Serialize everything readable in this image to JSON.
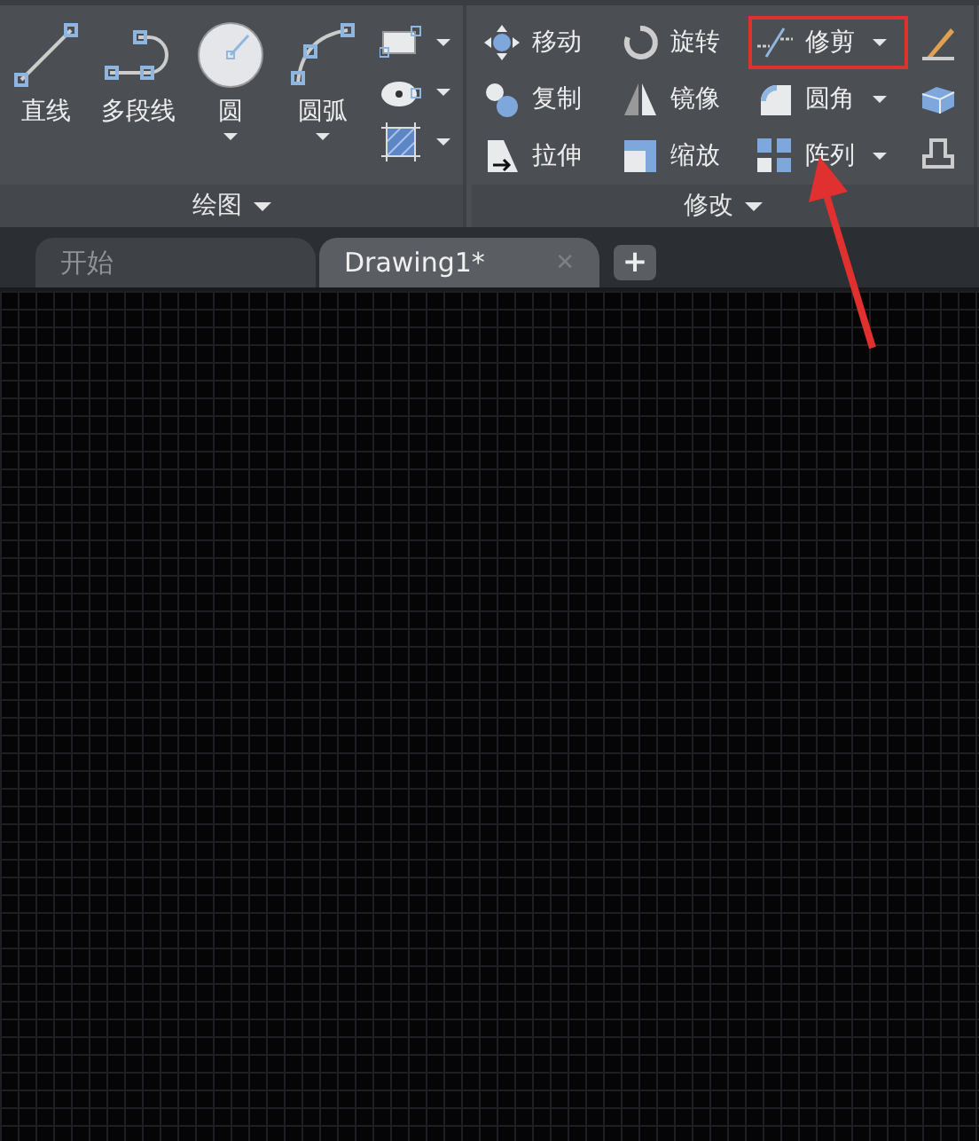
{
  "ribbon": {
    "panels": [
      {
        "kind": "draw",
        "title": "绘图",
        "big_tools": [
          {
            "label": "直线",
            "dropdown": false
          },
          {
            "label": "多段线",
            "dropdown": false
          },
          {
            "label": "圆",
            "dropdown": true
          },
          {
            "label": "圆弧",
            "dropdown": true
          }
        ],
        "small_tools": [
          {
            "dropdown": true
          },
          {
            "dropdown": true
          },
          {
            "dropdown": true
          }
        ]
      },
      {
        "kind": "modify",
        "title": "修改",
        "tools": [
          {
            "label": "移动",
            "dropdown": false,
            "highlighted": false
          },
          {
            "label": "旋转",
            "dropdown": false,
            "highlighted": false
          },
          {
            "label": "修剪",
            "dropdown": true,
            "highlighted": true
          },
          {
            "label": "复制",
            "dropdown": false,
            "highlighted": false
          },
          {
            "label": "镜像",
            "dropdown": false,
            "highlighted": false
          },
          {
            "label": "圆角",
            "dropdown": true,
            "highlighted": false
          },
          {
            "label": "拉伸",
            "dropdown": false,
            "highlighted": false
          },
          {
            "label": "缩放",
            "dropdown": false,
            "highlighted": false
          },
          {
            "label": "阵列",
            "dropdown": true,
            "highlighted": false
          }
        ]
      }
    ]
  },
  "file_tabs": [
    {
      "label": "开始",
      "selected": false
    },
    {
      "label": "Drawing1*",
      "selected": true,
      "close": "✕"
    }
  ],
  "new_tab": "+",
  "annotation_arrow": true
}
